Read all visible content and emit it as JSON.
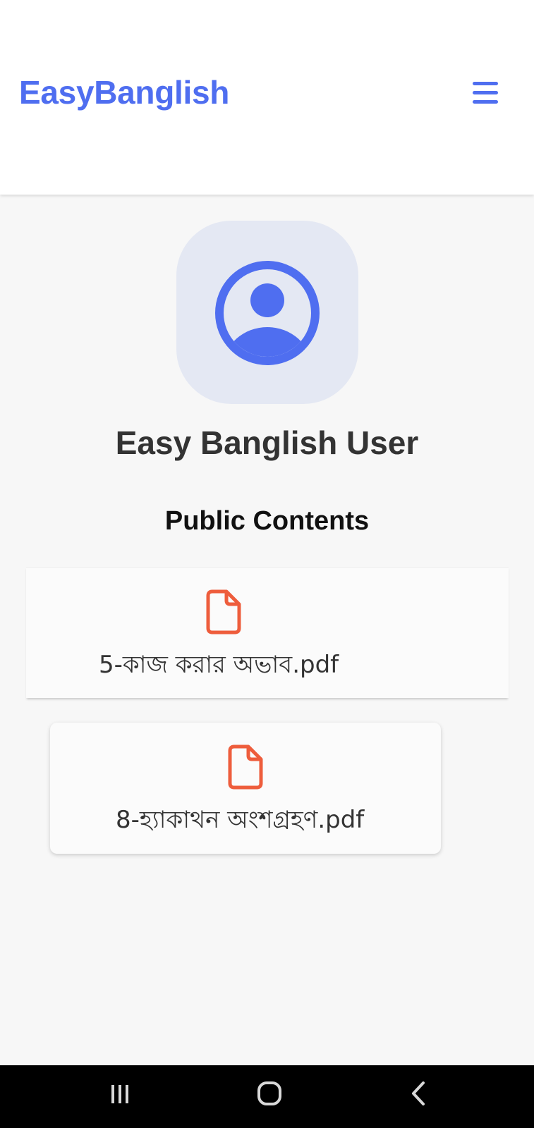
{
  "header": {
    "brand": "EasyBanglish",
    "menu_icon": "hamburger-menu-icon"
  },
  "profile": {
    "avatar_icon": "user-circle-icon",
    "name": "Easy Banglish User"
  },
  "section": {
    "title": "Public Contents"
  },
  "files": [
    {
      "name": "5-কাজ করার অভাব.pdf",
      "icon": "document-icon"
    },
    {
      "name": "8-হ্যাকাথন অংশগ্রহণ.pdf",
      "icon": "document-icon"
    }
  ],
  "navbar": {
    "recents_icon": "recent-apps-icon",
    "home_icon": "home-icon",
    "back_icon": "back-icon"
  },
  "colors": {
    "accent": "#4f6ef0",
    "avatar_bg": "#e4e8f3",
    "file_icon": "#ee5d3c",
    "nav_bg": "#000000"
  }
}
